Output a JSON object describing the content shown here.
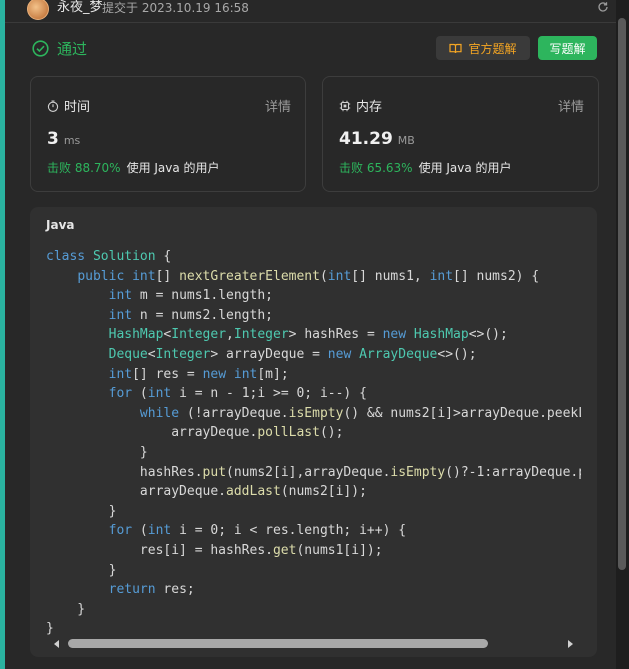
{
  "header": {
    "author": "永夜_梦",
    "submit_text": "提交于 2023.10.19 16:58"
  },
  "status": {
    "label": "通过",
    "color": "#2db55d"
  },
  "buttons": {
    "official_solution": "官方题解",
    "write_solution": "写题解"
  },
  "runtime": {
    "title": "时间",
    "detail": "详情",
    "value": "3",
    "unit": "ms",
    "beat": "击败 88.70%",
    "desc": "使用 Java 的用户"
  },
  "memory": {
    "title": "内存",
    "detail": "详情",
    "value": "41.29",
    "unit": "MB",
    "beat": "击败 65.63%",
    "desc": "使用 Java 的用户"
  },
  "code": {
    "language": "Java",
    "lines": [
      "class Solution {",
      "    public int[] nextGreaterElement(int[] nums1, int[] nums2) {",
      "        int m = nums1.length;",
      "        int n = nums2.length;",
      "        HashMap<Integer,Integer> hashRes = new HashMap<>();",
      "        Deque<Integer> arrayDeque = new ArrayDeque<>();",
      "        int[] res = new int[m];",
      "        for (int i = n - 1;i >= 0; i--) {",
      "            while (!arrayDeque.isEmpty() && nums2[i]>arrayDeque.peekL",
      "                arrayDeque.pollLast();",
      "            }",
      "            hashRes.put(nums2[i],arrayDeque.isEmpty()?-1:arrayDeque.p",
      "            arrayDeque.addLast(nums2[i]);",
      "        }",
      "        for (int i = 0; i < res.length; i++) {",
      "            res[i] = hashRes.get(nums1[i]);",
      "        }",
      "        return res;",
      "    }",
      "}"
    ]
  }
}
